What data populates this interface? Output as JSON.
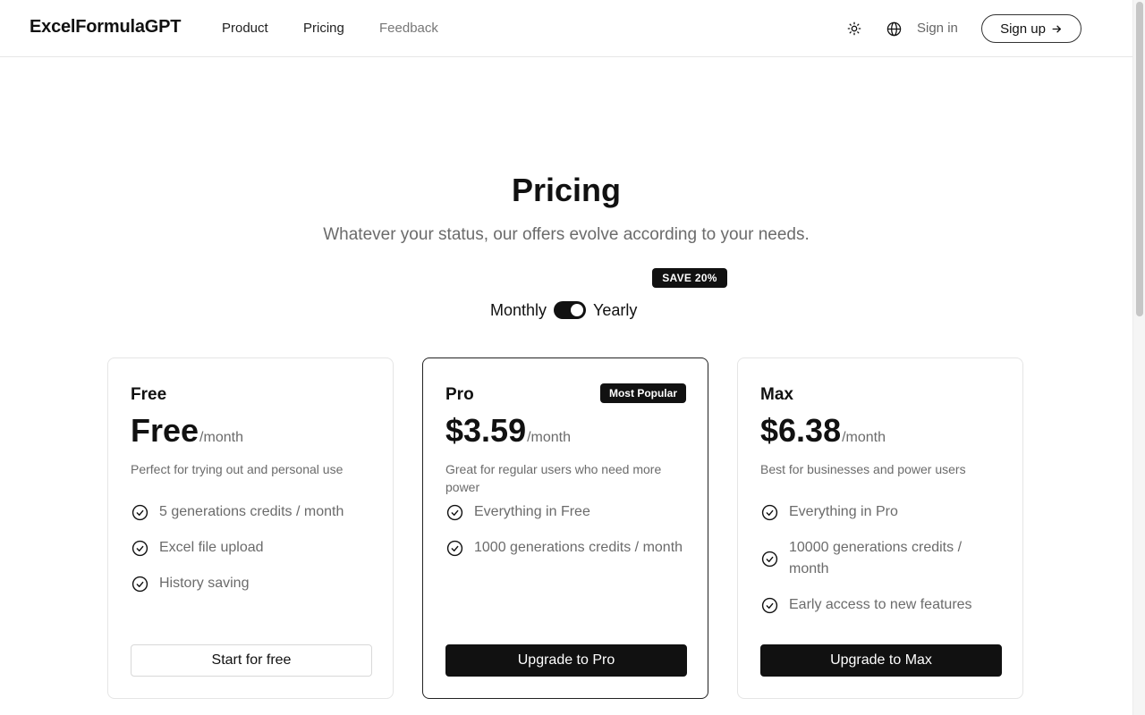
{
  "header": {
    "logo": "ExcelFormulaGPT",
    "nav": {
      "product": "Product",
      "pricing": "Pricing",
      "feedback": "Feedback"
    },
    "sign_in": "Sign in",
    "sign_up": "Sign up",
    "theme_icon": "sun-icon",
    "language_icon": "globe-icon"
  },
  "hero": {
    "title": "Pricing",
    "subtitle": "Whatever your status, our offers evolve according to your needs."
  },
  "billing": {
    "monthly_label": "Monthly",
    "yearly_label": "Yearly",
    "save_badge": "SAVE 20%",
    "selected": "yearly"
  },
  "plans": [
    {
      "name": "Free",
      "price": "Free",
      "per": "/month",
      "description": "Perfect for trying out and personal use",
      "features": [
        "5 generations credits / month",
        "Excel file upload",
        "History saving"
      ],
      "cta": "Start for free"
    },
    {
      "name": "Pro",
      "badge": "Most Popular",
      "price": "$3.59",
      "per": "/month",
      "description": "Great for regular users who need more power",
      "features": [
        "Everything in Free",
        "1000 generations credits / month"
      ],
      "cta": "Upgrade to Pro"
    },
    {
      "name": "Max",
      "price": "$6.38",
      "per": "/month",
      "description": "Best for businesses and power users",
      "features": [
        "Everything in Pro",
        "10000 generations credits / month",
        "Early access to new features"
      ],
      "cta": "Upgrade to Max"
    }
  ],
  "colors": {
    "primary": "#111111",
    "muted_text": "#6b6b6b",
    "border": "#e5e5e5"
  }
}
